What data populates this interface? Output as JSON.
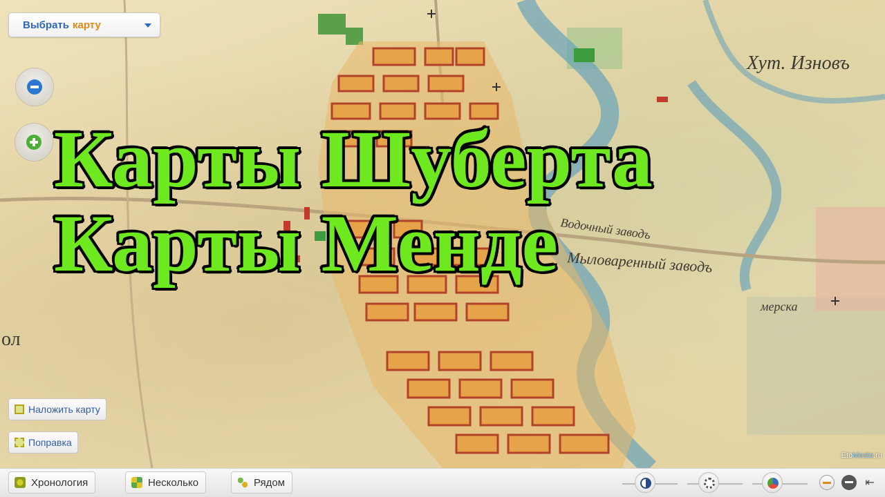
{
  "map": {
    "select": {
      "label": "Выбрать",
      "accent": "карту"
    },
    "labels": [
      "Хут. Изновъ",
      "Мыловаренный заводъ",
      "Водочный заводъ",
      "ол",
      "мерска"
    ],
    "watermark": {
      "prefix": "Eto",
      "mid": "Mesto",
      "suffix": ".ru"
    }
  },
  "title": {
    "line1": "Карты Шуберта",
    "line2": "Карты Менде"
  },
  "overlay_buttons": {
    "overlay": "Наложить карту",
    "fix": "Поправка"
  },
  "toolbar": {
    "chronology": "Хронология",
    "several": "Несколько",
    "nearby": "Рядом"
  },
  "colors": {
    "title_green": "#6ee81f",
    "link_blue": "#2d67b5",
    "accent_orange": "#e08a16"
  },
  "icons": [
    "zoom-out-icon",
    "zoom-in-icon",
    "chevron-down-icon",
    "contrast-icon",
    "brightness-icon",
    "color-icon",
    "opacity-down-icon",
    "opacity-minus-icon",
    "back-arrow-icon"
  ]
}
